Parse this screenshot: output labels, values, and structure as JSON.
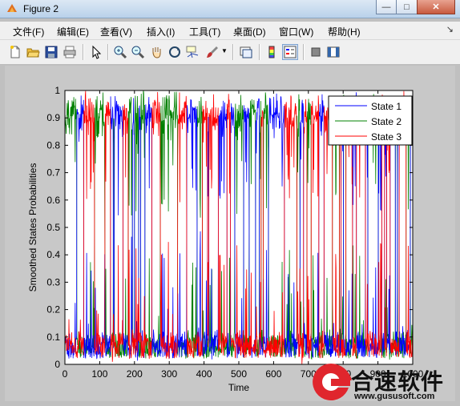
{
  "window": {
    "title": "Figure 2",
    "minimize_glyph": "—",
    "maximize_glyph": "□",
    "close_glyph": "✕"
  },
  "menu": {
    "items": [
      "文件(F)",
      "编辑(E)",
      "查看(V)",
      "插入(I)",
      "工具(T)",
      "桌面(D)",
      "窗口(W)",
      "帮助(H)"
    ],
    "overflow_glyph": "↘"
  },
  "toolbar": {
    "buttons": [
      "new-figure-icon",
      "open-file-icon",
      "save-icon",
      "print-icon",
      "edit-plot-arrow-icon",
      "zoom-in-icon",
      "zoom-out-icon",
      "pan-hand-icon",
      "rotate-3d-icon",
      "data-cursor-icon",
      "brush-icon",
      "brush-dropdown-icon",
      "link-plot-icon",
      "insert-colorbar-icon",
      "insert-legend-icon",
      "hide-plot-tools-icon",
      "show-plot-tools-icon"
    ]
  },
  "chart_data": {
    "type": "line",
    "title": "",
    "xlabel": "Time",
    "ylabel": "Smoothed States Probabilities",
    "xlim": [
      0,
      1000
    ],
    "ylim": [
      0,
      1
    ],
    "xticks": [
      "0",
      "100",
      "200",
      "300",
      "400",
      "500",
      "600",
      "700",
      "800",
      "900",
      "1000"
    ],
    "yticks": [
      "0",
      "0.1",
      "0.2",
      "0.3",
      "0.4",
      "0.5",
      "0.6",
      "0.7",
      "0.8",
      "0.9",
      "1"
    ],
    "grid": false,
    "legend_position": "top-right",
    "series": [
      {
        "name": "State 1",
        "color": "#0000ff"
      },
      {
        "name": "State 2",
        "color": "#008000"
      },
      {
        "name": "State 3",
        "color": "#ff0000"
      }
    ],
    "points_per_series": 1000,
    "note_values": "dense regime-switching probabilities oscillating between 0 and 1 across all 1000 time steps"
  },
  "watermark": {
    "cn": "合速软件",
    "url": "www.gususoft.com",
    "logo_color": "#e0262d"
  }
}
